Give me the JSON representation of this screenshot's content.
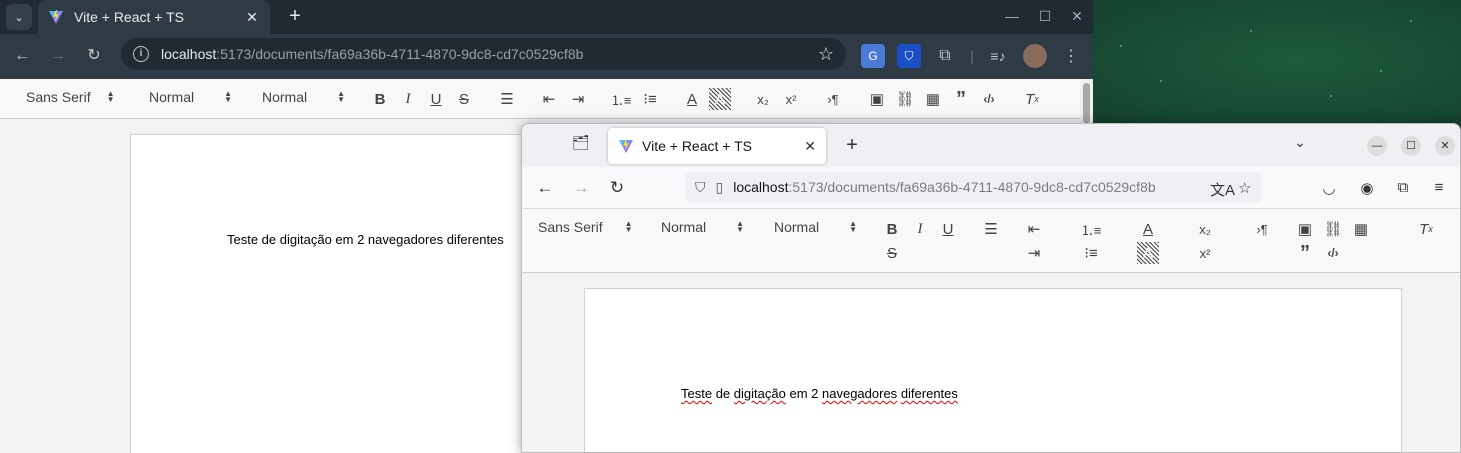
{
  "chrome": {
    "tab_menu_icon": "chevron-down-icon",
    "tab": {
      "title": "Vite + React + TS",
      "close_label": "✕"
    },
    "new_tab_label": "+",
    "url": {
      "host": "localhost",
      "path": ":5173/documents/fa69a36b-4711-4870-9dc8-cd7c0529cf8b"
    },
    "editor": {
      "font_select": "Sans Serif",
      "size_select": "Normal",
      "header_select": "Normal"
    },
    "document_text": "Teste de digitação em 2 navegadores diferentes"
  },
  "firefox": {
    "tab": {
      "title": "Vite + React + TS",
      "close_label": "✕"
    },
    "new_tab_label": "+",
    "url": {
      "host": "localhost",
      "path": ":5173/documents/fa69a36b-4711-4870-9dc8-cd7c0529cf8b"
    },
    "editor": {
      "font_select": "Sans Serif",
      "size_select": "Normal",
      "header_select": "Normal"
    },
    "document_words": [
      "Teste",
      "de",
      "digitação",
      "em",
      "2",
      "navegadores",
      "diferentes"
    ]
  },
  "colors": {
    "chrome_dark": "#2f3b44",
    "chrome_tabbar": "#1f2a33",
    "firefox_bg": "#f9f9fb",
    "spellcheck_underline": "#d00000",
    "desktop_aurora": "#1d5a3c"
  }
}
